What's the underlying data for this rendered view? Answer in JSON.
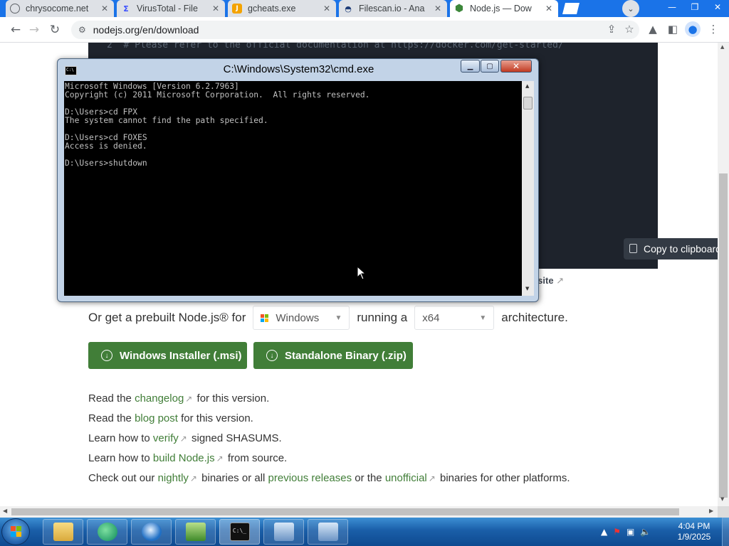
{
  "tabs": [
    {
      "title": "chrysocome.net",
      "icon": "globe-icon"
    },
    {
      "title": "VirusTotal - File",
      "icon": "virustotal-icon"
    },
    {
      "title": "gcheats.exe",
      "icon": "shield-icon"
    },
    {
      "title": "Filescan.io - Ana",
      "icon": "filescan-icon"
    },
    {
      "title": "Node.js — Dow",
      "icon": "nodejs-icon",
      "active": true
    }
  ],
  "address_bar": {
    "url": "nodejs.org/en/download"
  },
  "page": {
    "code_line_number": "2",
    "code_line": "# Please refer to the official documentation at https://docker.com/get-started/",
    "copy_button": "Copy to clipboard",
    "website_link": "ebsite",
    "prebuilt": {
      "prefix": "Or get a prebuilt Node.js® for",
      "os_value": "Windows",
      "middle": "running a",
      "arch_value": "x64",
      "suffix": "architecture."
    },
    "download_buttons": [
      "Windows Installer (.msi)",
      "Standalone Binary (.zip)"
    ],
    "info_lines": {
      "changelog": {
        "pre": "Read the",
        "link": "changelog",
        "post": "for this version."
      },
      "blog": {
        "pre": "Read the",
        "link": "blog post",
        "post": "for this version."
      },
      "verify": {
        "pre": "Learn how to",
        "link": "verify",
        "post": "signed SHASUMS."
      },
      "build": {
        "pre": "Learn how to",
        "link": "build Node.js",
        "post": "from source."
      },
      "nightly": {
        "pre": "Check out our",
        "link1": "nightly",
        "mid1": "binaries or all",
        "link2": "previous releases",
        "mid2": "or the",
        "link3": "unofficial",
        "post": "binaries for other platforms."
      }
    }
  },
  "cmd_window": {
    "title": "C:\\Windows\\System32\\cmd.exe",
    "console_text": "Microsoft Windows [Version 6.2.7963]\nCopyright (c) 2011 Microsoft Corporation.  All rights reserved.\n\nD:\\Users>cd FPX\nThe system cannot find the path specified.\n\nD:\\Users>cd FOXES\nAccess is denied.\n\nD:\\Users>shutdown"
  },
  "taskbar": {
    "items": [
      "explorer-icon",
      "edge-icon",
      "ie-icon",
      "network-icon",
      "cmd-icon",
      "remote-desktop-icon",
      "remote-desktop-icon-2"
    ],
    "clock_time": "4:04 PM",
    "clock_date": "1/9/2025"
  },
  "colors": {
    "node_green": "#417e38",
    "chrome_blue": "#1a73e8",
    "console_bg": "#000000"
  }
}
